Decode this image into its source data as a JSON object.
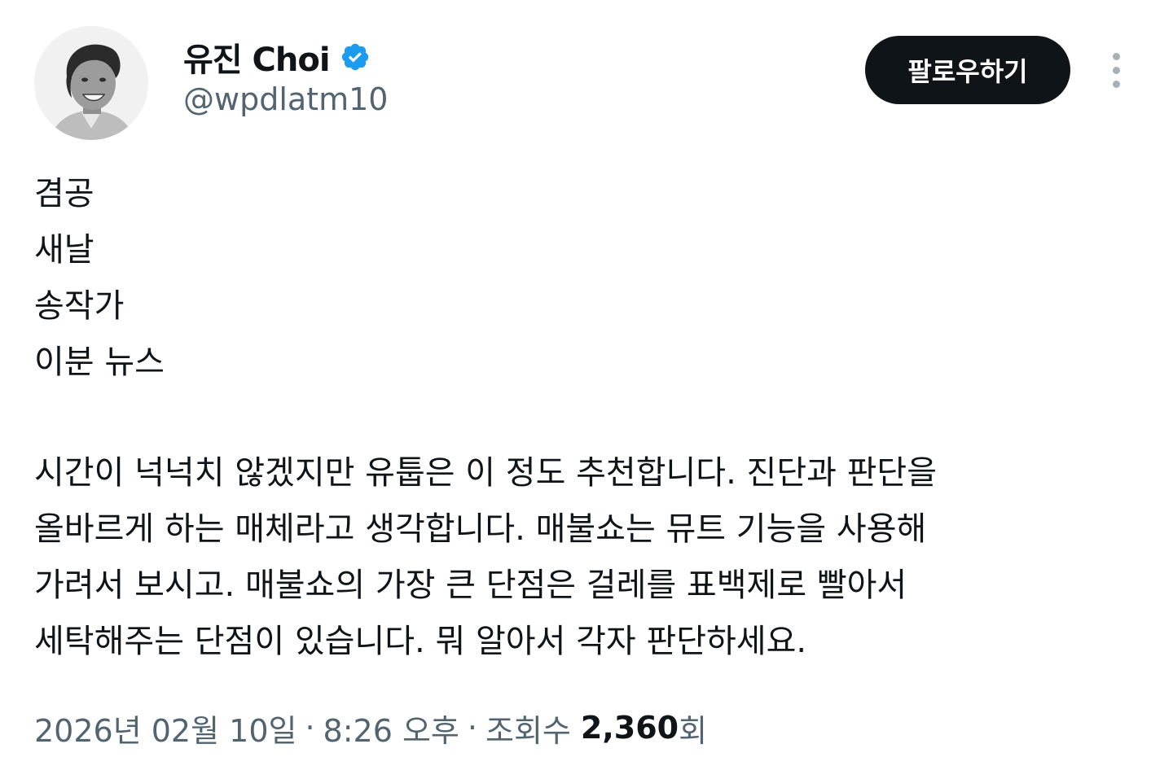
{
  "user": {
    "display_name": "유진 Choi",
    "handle": "@wpdlatm10",
    "verified": true,
    "verified_color": "#1d9bf0"
  },
  "follow_button": {
    "label": "팔로우하기"
  },
  "more_button": {
    "icon": "more-vertical-icon"
  },
  "tweet": {
    "list_lines": [
      "겸공",
      "새날",
      "송작가",
      "이분 뉴스"
    ],
    "paragraph_lines": [
      "시간이 넉넉치 않겠지만 유툽은 이 정도 추천합니다. 진단과 판단을",
      "올바르게 하는 매체라고 생각합니다. 매불쇼는 뮤트 기능을 사용해",
      "가려서 보시고. 매불쇼의 가장 큰 단점은 걸레를 표백제로 빨아서",
      "세탁해주는 단점이 있습니다. 뭐 알아서 각자 판단하세요."
    ]
  },
  "meta": {
    "date": "2026년 02월 10일",
    "separator": "·",
    "time": "8:26 오후",
    "views_label": "조회수",
    "views_count": "2,360",
    "views_suffix": "회"
  },
  "colors": {
    "text_primary": "#0f1419",
    "text_secondary": "#536471",
    "button_bg": "#0f1419",
    "accent": "#1d9bf0"
  }
}
